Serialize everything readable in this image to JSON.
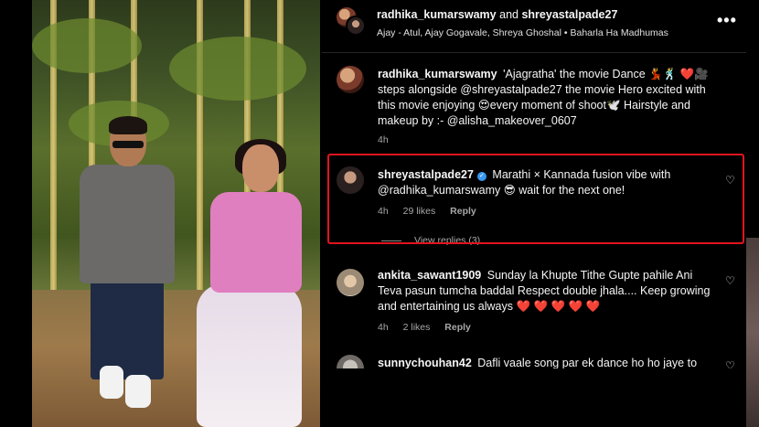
{
  "header": {
    "user1": "radhika_kumarswamy",
    "and_text": "and",
    "user2": "shreyastalpade27",
    "music_artists": "Ajay - Atul, Ajay Gogavale, Shreya Ghoshal",
    "music_separator": "•",
    "music_title": "Baharla Ha Madhumas",
    "more_label": "•••"
  },
  "caption": {
    "username": "radhika_kumarswamy",
    "text": "'Ajagratha' the movie Dance 💃🕺 ❤️🎥 steps alongside @shreyastalpade27 the movie Hero excited with this movie enjoying 😍every moment of shoot🕊️ Hairstyle and makeup by :- @alisha_makeover_0607",
    "time": "4h"
  },
  "comments": [
    {
      "username": "shreyastalpade27",
      "verified": true,
      "text": "Marathi × Kannada fusion vibe with @radhika_kumarswamy 😎 wait for the next one!",
      "time": "4h",
      "likes": "29 likes",
      "reply": "Reply",
      "view_replies": "View replies (3)"
    },
    {
      "username": "ankita_sawant1909",
      "text": "Sunday la Khupte Tithe Gupte pahile Ani Teva pasun tumcha baddal Respect double jhala.... Keep growing and entertaining us always",
      "hearts": "❤️ ❤️ ❤️ ❤️ ❤️",
      "time": "4h",
      "likes": "2 likes",
      "reply": "Reply"
    },
    {
      "username": "sunnychouhan42",
      "text": "Dafli vaale song par ek dance ho ho jaye to"
    }
  ],
  "colors": {
    "background": "#000000",
    "text": "#f5f5f5",
    "muted": "#a8a8a8",
    "highlight_box": "#e1141e",
    "heart": "#ed2b3a",
    "verified": "#3897f0"
  },
  "icons": {
    "like": "heart-outline-icon",
    "more": "more-options-icon",
    "verified": "verified-badge-icon"
  }
}
